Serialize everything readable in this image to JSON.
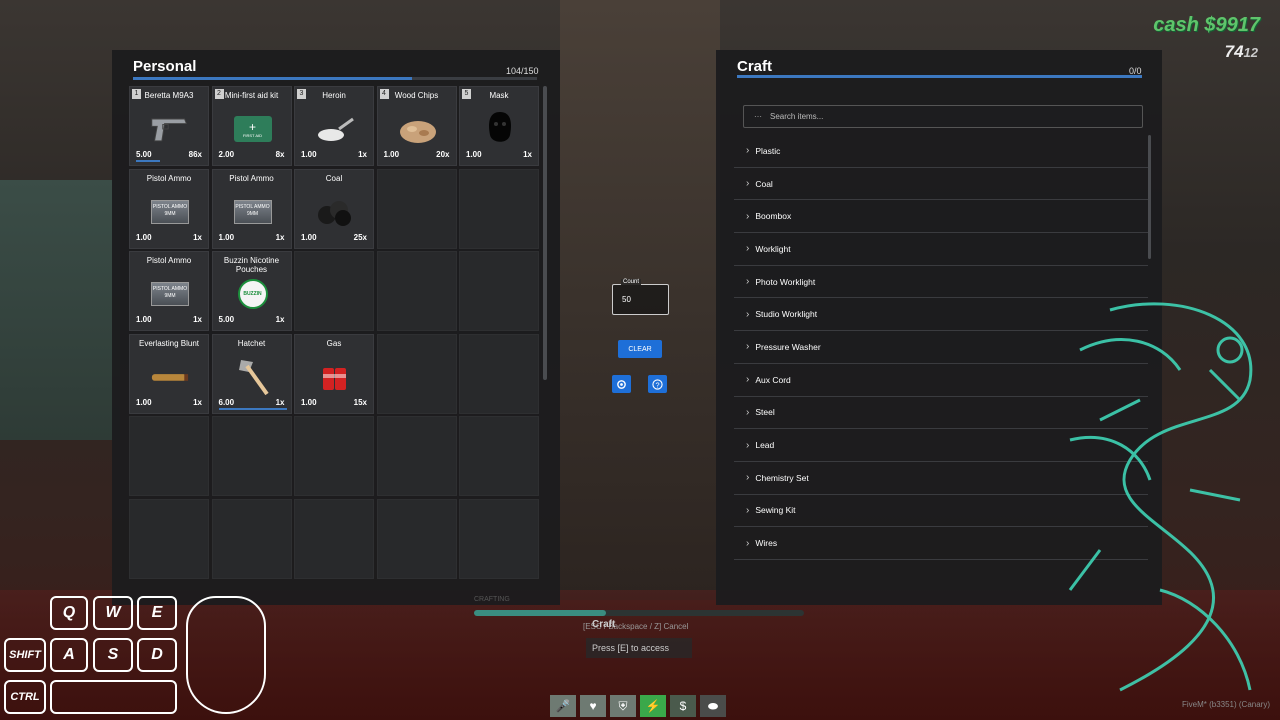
{
  "hud": {
    "cash_label": "cash $9917",
    "ammo_clip": "74",
    "ammo_reserve": "12"
  },
  "inventory": {
    "title": "Personal",
    "weight": "104/150",
    "weight_fraction": 0.69,
    "slots": [
      {
        "slot": "1",
        "name": "Beretta M9A3",
        "weight": "5.00",
        "qty": "86x",
        "icon": "pistol-icon",
        "durability": 0.35
      },
      {
        "slot": "2",
        "name": "Mini-first aid kit",
        "weight": "2.00",
        "qty": "8x",
        "icon": "first-aid-icon",
        "icon_text": "FIRST AID"
      },
      {
        "slot": "3",
        "name": "Heroin",
        "weight": "1.00",
        "qty": "1x",
        "icon": "heroin-icon"
      },
      {
        "slot": "4",
        "name": "Wood Chips",
        "weight": "1.00",
        "qty": "20x",
        "icon": "wood-chips-icon"
      },
      {
        "slot": "5",
        "name": "Mask",
        "weight": "1.00",
        "qty": "1x",
        "icon": "mask-icon"
      },
      {
        "name": "Pistol Ammo",
        "weight": "1.00",
        "qty": "1x",
        "icon": "ammo-box-icon",
        "icon_text": "PISTOL AMMO 9MM"
      },
      {
        "name": "Pistol Ammo",
        "weight": "1.00",
        "qty": "1x",
        "icon": "ammo-box-icon",
        "icon_text": "PISTOL AMMO 9MM"
      },
      {
        "name": "Coal",
        "weight": "1.00",
        "qty": "25x",
        "icon": "coal-icon"
      },
      {
        "empty": true
      },
      {
        "empty": true
      },
      {
        "name": "Pistol Ammo",
        "weight": "1.00",
        "qty": "1x",
        "icon": "ammo-box-icon",
        "icon_text": "PISTOL AMMO 9MM"
      },
      {
        "name": "Buzzin Nicotine Pouches",
        "weight": "5.00",
        "qty": "1x",
        "icon": "nicotine-tin-icon",
        "icon_text": "BUZZIN"
      },
      {
        "empty": true
      },
      {
        "empty": true
      },
      {
        "empty": true
      },
      {
        "name": "Everlasting Blunt",
        "weight": "1.00",
        "qty": "1x",
        "icon": "blunt-icon"
      },
      {
        "name": "Hatchet",
        "weight": "6.00",
        "qty": "1x",
        "icon": "hatchet-icon",
        "durability": 1.0
      },
      {
        "name": "Gas",
        "weight": "1.00",
        "qty": "15x",
        "icon": "gas-can-icon"
      },
      {
        "empty": true
      },
      {
        "empty": true
      },
      {
        "empty": true
      },
      {
        "empty": true
      },
      {
        "empty": true
      },
      {
        "empty": true
      },
      {
        "empty": true
      },
      {
        "empty": true
      },
      {
        "empty": true
      },
      {
        "empty": true
      },
      {
        "empty": true
      },
      {
        "empty": true
      }
    ]
  },
  "middle": {
    "count_label": "Count",
    "count_value": "50",
    "clear_label": "CLEAR",
    "icon_left": "settings-icon",
    "icon_right": "help-icon"
  },
  "craft": {
    "title": "Craft",
    "count": "0/0",
    "search_placeholder": "Search items...",
    "recipes": [
      "Plastic",
      "Coal",
      "Boombox",
      "Worklight",
      "Photo Worklight",
      "Studio Worklight",
      "Pressure Washer",
      "Aux Cord",
      "Steel",
      "Lead",
      "Chemistry Set",
      "Sewing Kit",
      "Wires"
    ]
  },
  "progress": {
    "label": "CRAFTING",
    "value": 0.4
  },
  "prompt": {
    "title": "Craft",
    "hint": "[ESC / Backspace / Z] Cancel",
    "text": "Press [E] to access"
  },
  "status_icons": [
    {
      "icon": "mic-icon",
      "color": "#6e7a72"
    },
    {
      "icon": "heart-icon",
      "color": "#6e7a72"
    },
    {
      "icon": "shield-icon",
      "color": "#6e7a72"
    },
    {
      "icon": "lightning-icon",
      "color": "#3aa84a"
    },
    {
      "icon": "dollar-icon",
      "color": "#4a5a4c"
    },
    {
      "icon": "pills-icon",
      "color": "#4a4c4a"
    }
  ],
  "keys": [
    "Q",
    "W",
    "E",
    "SHIFT",
    "A",
    "S",
    "D",
    "CTRL"
  ],
  "footer": "FiveM* (b3351) (Canary)"
}
